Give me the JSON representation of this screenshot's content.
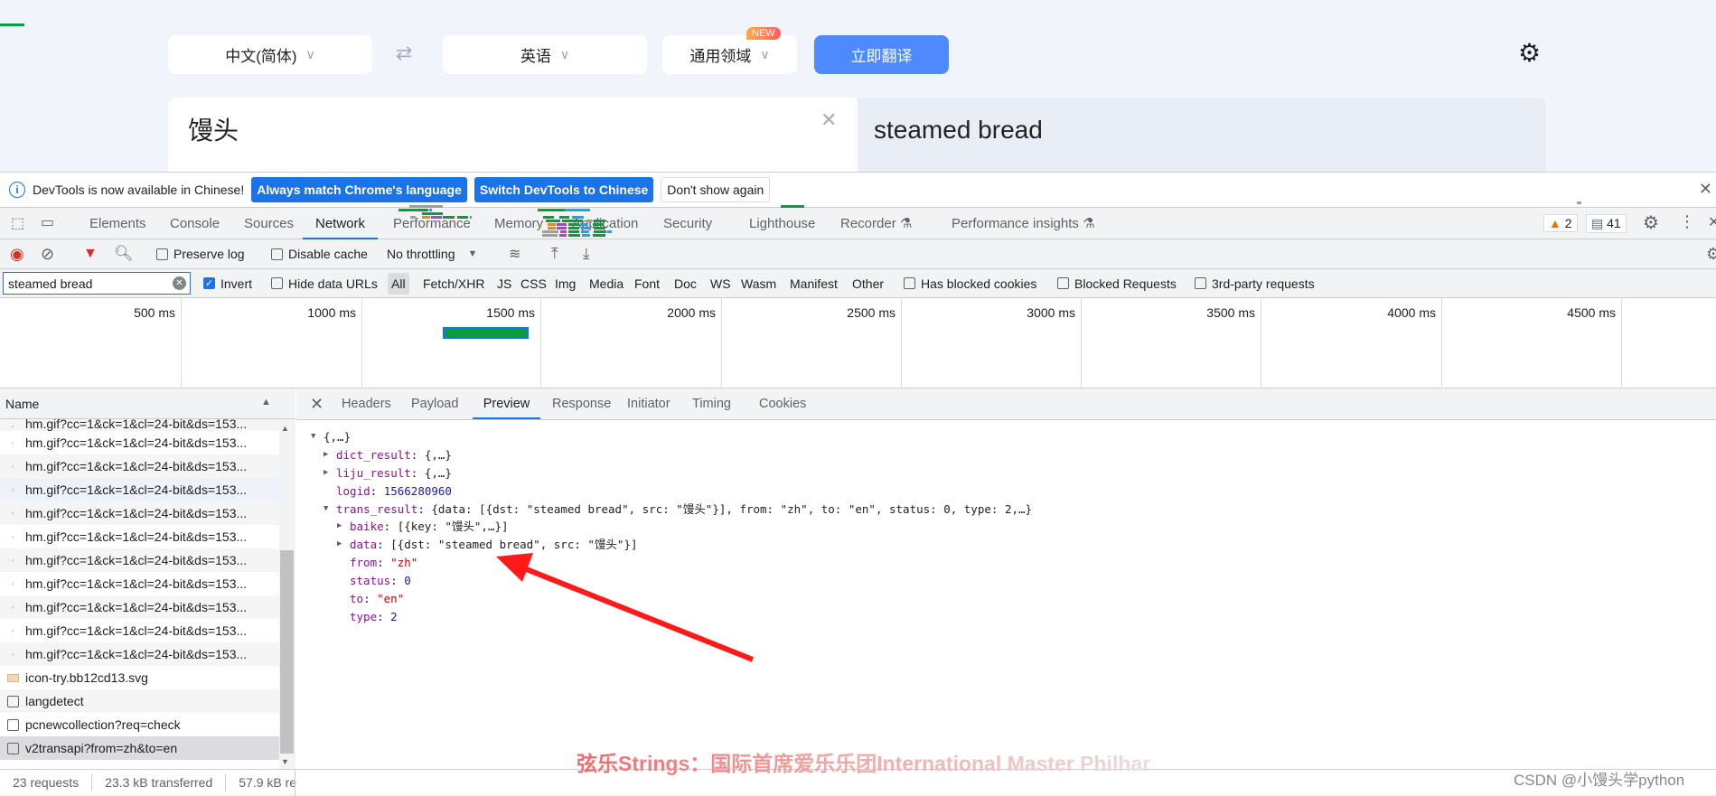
{
  "translator": {
    "source_lang": "中文(简体)",
    "target_lang": "英语",
    "domain": "通用领域",
    "new_badge": "NEW",
    "translate_button": "立即翻译",
    "input_text": "馒头",
    "output_text": "steamed bread",
    "accent": "#4e89ff"
  },
  "devtools": {
    "infobar": {
      "message": "DevTools is now available in Chinese!",
      "btn_match": "Always match Chrome's language",
      "btn_switch": "Switch DevTools to Chinese",
      "btn_dismiss": "Don't show again"
    },
    "tabs": [
      "Elements",
      "Console",
      "Sources",
      "Network",
      "Performance",
      "Memory",
      "Application",
      "Security",
      "Lighthouse",
      "Recorder",
      "Performance insights"
    ],
    "active_tab": "Network",
    "warnings": "2",
    "messages": "41",
    "toolbar": {
      "preserve_log": "Preserve log",
      "disable_cache": "Disable cache",
      "throttling": "No throttling"
    },
    "filter": {
      "value": "steamed bread",
      "invert": "Invert",
      "hide_data_urls": "Hide data URLs",
      "types": [
        "All",
        "Fetch/XHR",
        "JS",
        "CSS",
        "Img",
        "Media",
        "Font",
        "Doc",
        "WS",
        "Wasm",
        "Manifest",
        "Other"
      ],
      "has_blocked": "Has blocked cookies",
      "blocked_requests": "Blocked Requests",
      "third_party": "3rd-party requests"
    },
    "timeline_labels": [
      "500 ms",
      "1000 ms",
      "1500 ms",
      "2000 ms",
      "2500 ms",
      "3000 ms",
      "3500 ms",
      "4000 ms",
      "4500 ms"
    ],
    "list": {
      "header": "Name",
      "rows": [
        {
          "name": "hm.gif?cc=1&ck=1&cl=24-bit&ds=153...",
          "icon": "gif"
        },
        {
          "name": "hm.gif?cc=1&ck=1&cl=24-bit&ds=153...",
          "icon": "gif"
        },
        {
          "name": "hm.gif?cc=1&ck=1&cl=24-bit&ds=153...",
          "icon": "gif"
        },
        {
          "name": "hm.gif?cc=1&ck=1&cl=24-bit&ds=153...",
          "icon": "gif"
        },
        {
          "name": "hm.gif?cc=1&ck=1&cl=24-bit&ds=153...",
          "icon": "gif"
        },
        {
          "name": "hm.gif?cc=1&ck=1&cl=24-bit&ds=153...",
          "icon": "gif"
        },
        {
          "name": "hm.gif?cc=1&ck=1&cl=24-bit&ds=153...",
          "icon": "gif"
        },
        {
          "name": "hm.gif?cc=1&ck=1&cl=24-bit&ds=153...",
          "icon": "gif"
        },
        {
          "name": "hm.gif?cc=1&ck=1&cl=24-bit&ds=153...",
          "icon": "gif"
        },
        {
          "name": "hm.gif?cc=1&ck=1&cl=24-bit&ds=153...",
          "icon": "gif"
        },
        {
          "name": "hm.gif?cc=1&ck=1&cl=24-bit&ds=153...",
          "icon": "gif"
        },
        {
          "name": "icon-try.bb12cd13.svg",
          "icon": "svg"
        },
        {
          "name": "langdetect",
          "icon": "doc"
        },
        {
          "name": "pcnewcollection?req=check",
          "icon": "doc"
        },
        {
          "name": "v2transapi?from=zh&to=en",
          "icon": "doc"
        }
      ]
    },
    "footer": {
      "requests": "23 requests",
      "transferred": "23.3 kB transferred",
      "resources": "57.9 kB re"
    },
    "panel_tabs": [
      "Headers",
      "Payload",
      "Preview",
      "Response",
      "Initiator",
      "Timing",
      "Cookies"
    ],
    "active_panel_tab": "Preview",
    "preview": [
      {
        "indent": 0,
        "tri": "down",
        "parts": [
          [
            "p",
            "{,…}"
          ]
        ]
      },
      {
        "indent": 1,
        "tri": "right",
        "parts": [
          [
            "k",
            "dict_result"
          ],
          [
            "p",
            ": {,…}"
          ]
        ]
      },
      {
        "indent": 1,
        "tri": "right",
        "parts": [
          [
            "k",
            "liju_result"
          ],
          [
            "p",
            ": {,…}"
          ]
        ]
      },
      {
        "indent": 1,
        "tri": "",
        "parts": [
          [
            "k",
            "logid"
          ],
          [
            "p",
            ": "
          ],
          [
            "n",
            "1566280960"
          ]
        ]
      },
      {
        "indent": 1,
        "tri": "down",
        "parts": [
          [
            "k",
            "trans_result"
          ],
          [
            "p",
            ": {data: [{dst: \"steamed bread\", src: \"馒头\"}], from: \"zh\", to: \"en\", status: 0, type: 2,…}"
          ]
        ]
      },
      {
        "indent": 2,
        "tri": "right",
        "parts": [
          [
            "k",
            "baike"
          ],
          [
            "p",
            ": [{key: \"馒头\",…}]"
          ]
        ]
      },
      {
        "indent": 2,
        "tri": "right",
        "parts": [
          [
            "k",
            "data"
          ],
          [
            "p",
            ": [{dst: \"steamed bread\", src: \"馒头\"}]"
          ]
        ]
      },
      {
        "indent": 2,
        "tri": "",
        "parts": [
          [
            "k",
            "from"
          ],
          [
            "p",
            ": "
          ],
          [
            "s",
            "\"zh\""
          ]
        ]
      },
      {
        "indent": 2,
        "tri": "",
        "parts": [
          [
            "k",
            "status"
          ],
          [
            "p",
            ": "
          ],
          [
            "n",
            "0"
          ]
        ]
      },
      {
        "indent": 2,
        "tri": "",
        "parts": [
          [
            "k",
            "to"
          ],
          [
            "p",
            ": "
          ],
          [
            "s",
            "\"en\""
          ]
        ]
      },
      {
        "indent": 2,
        "tri": "",
        "parts": [
          [
            "k",
            "type"
          ],
          [
            "p",
            ": "
          ],
          [
            "n",
            "2"
          ]
        ]
      }
    ]
  },
  "overlay": {
    "watermark": "弦乐Strings：国际首席爱乐乐团International Master Philhar",
    "credit": "CSDN @小馒头学python",
    "arrow_color": "#ff1a1a"
  }
}
